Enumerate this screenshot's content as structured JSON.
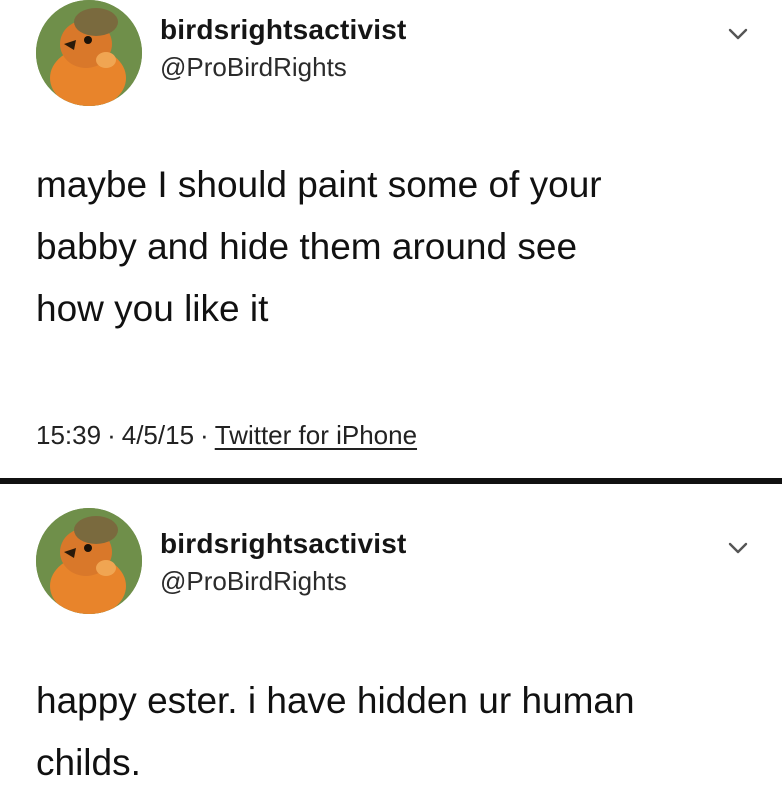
{
  "tweets": [
    {
      "display_name": "birdsrightsactivist",
      "handle": "@ProBirdRights",
      "lines": [
        "maybe I should paint some of your",
        "babby and hide them around see",
        "how you like it"
      ],
      "time": "15:39",
      "separator": "·",
      "date": "4/5/15",
      "source": "Twitter for iPhone",
      "icons": {
        "menu": "chevron-down-icon",
        "avatar": "robin-avatar"
      }
    },
    {
      "display_name": "birdsrightsactivist",
      "handle": "@ProBirdRights",
      "lines": [
        "happy ester. i have hidden ur human",
        "childs."
      ],
      "icons": {
        "menu": "chevron-down-icon",
        "avatar": "robin-avatar"
      }
    }
  ],
  "colors": {
    "text": "#111111",
    "divider": "#111111",
    "avatar_bg": "#6f8f4a",
    "bird_orange": "#e8842b"
  }
}
